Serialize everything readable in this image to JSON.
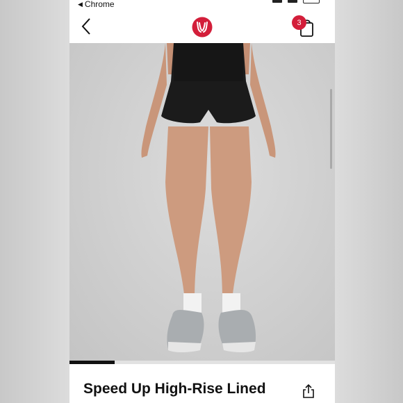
{
  "status_bar": {
    "back_app_label": "Chrome"
  },
  "header": {
    "cart_count": "3",
    "brand_color": "#d31e3a"
  },
  "icons": {
    "back": "chevron-left-icon",
    "logo": "lululemon-logo",
    "cart": "shopping-bag-icon",
    "share": "share-icon"
  },
  "gallery": {
    "progress": 0.17
  },
  "product": {
    "title": "Speed Up High-Rise Lined"
  }
}
